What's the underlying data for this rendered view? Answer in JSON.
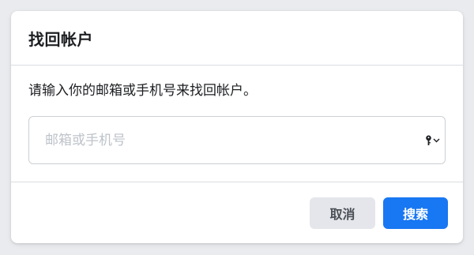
{
  "dialog": {
    "title": "找回帐户",
    "instruction": "请输入你的邮箱或手机号来找回帐户。",
    "input": {
      "value": "",
      "placeholder": "邮箱或手机号",
      "autofill_icon": "key-icon"
    },
    "buttons": {
      "cancel_label": "取消",
      "search_label": "搜索"
    }
  },
  "colors": {
    "primary": "#1877f2",
    "secondary_bg": "#e4e6eb",
    "page_bg": "#e9ebee"
  }
}
